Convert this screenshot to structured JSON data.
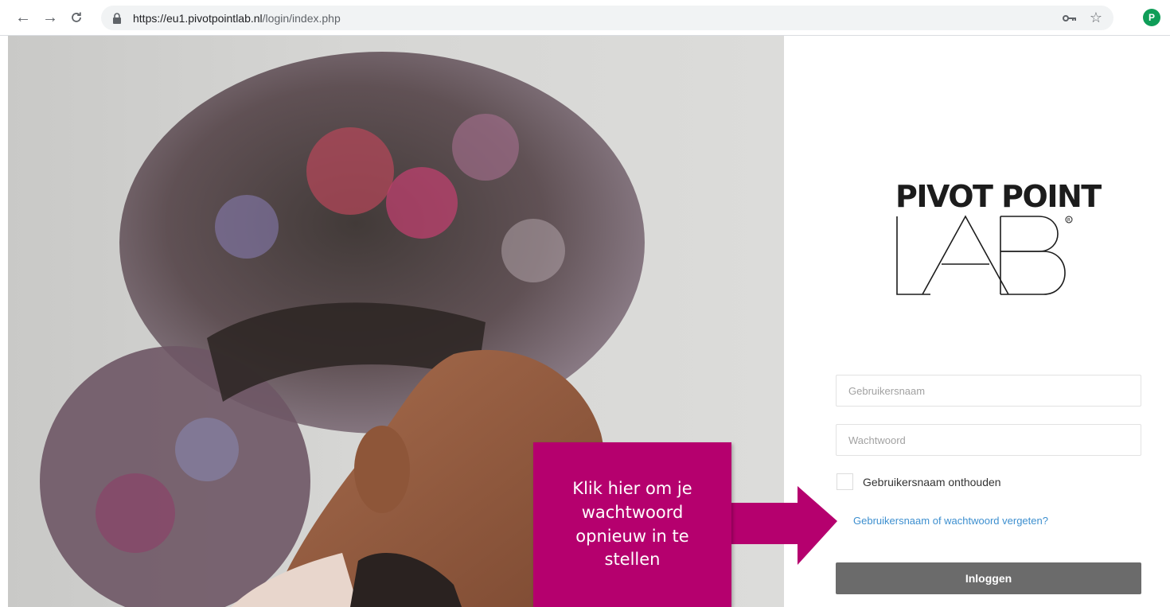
{
  "browser": {
    "url_domain": "https://eu1.pivotpointlab.nl",
    "url_path": "/login/index.php",
    "profile_initial": "P"
  },
  "logo": {
    "line1": "PIVOT POINT",
    "line2": "LAB"
  },
  "login": {
    "username_placeholder": "Gebruikersnaam",
    "password_placeholder": "Wachtwoord",
    "remember_label": "Gebruikersnaam onthouden",
    "forgot_link": "Gebruikersnaam of wachtwoord vergeten?",
    "submit_label": "Inloggen"
  },
  "annotation": {
    "text": "Klik hier om je wachtwoord opnieuw in te stellen"
  },
  "colors": {
    "callout": "#b5006e",
    "link": "#3d8fcf",
    "button": "#6b6b6b",
    "avatar": "#0f9d58"
  },
  "icons": {
    "back": "arrow-left-icon",
    "forward": "arrow-right-icon",
    "reload": "reload-icon",
    "lock": "lock-icon",
    "key": "key-icon",
    "star": "star-icon"
  }
}
